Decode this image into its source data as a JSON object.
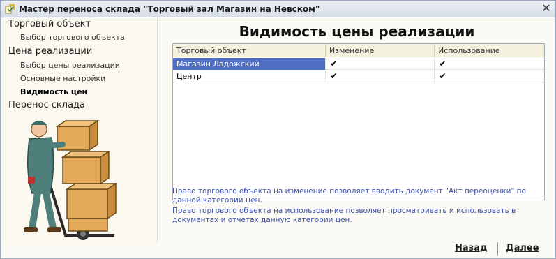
{
  "window": {
    "title": "Мастер переноса склада \"Торговый зал Магазин на Невском\"",
    "close_glyph": "✕"
  },
  "sidebar": {
    "items": [
      {
        "label": "Торговый объект",
        "level": 1
      },
      {
        "label": "Выбор торгового объекта",
        "level": 2
      },
      {
        "label": "Цена реализации",
        "level": 1
      },
      {
        "label": "Выбор цены реализации",
        "level": 2
      },
      {
        "label": "Основные настройки",
        "level": 2
      },
      {
        "label": "Видимость цен",
        "level": 2,
        "active": true
      },
      {
        "label": "Перенос склада",
        "level": 1
      }
    ]
  },
  "main": {
    "title": "Видимость цены реализации",
    "table": {
      "columns": [
        "Торговый объект",
        "Изменение",
        "Использование"
      ],
      "rows": [
        {
          "object": "Магазин Ладожский",
          "change": true,
          "use": true,
          "selected": true
        },
        {
          "object": "Центр",
          "change": true,
          "use": true,
          "selected": false
        }
      ]
    },
    "help": [
      "Право торгового объекта на изменение позволяет вводить документ \"Акт переоценки\" по данной категории цен.",
      "Право торгового объекта на использование позволяет просматривать и использовать в документах и отчетах данную категории цен."
    ]
  },
  "footer": {
    "back_label": "Назад",
    "next_label": "Далее"
  },
  "colors": {
    "selection": "#4f6fc4",
    "help_text": "#3a4fa8",
    "sidebar_bg": "#fbf9ef"
  },
  "icons": {
    "check": "✔"
  }
}
